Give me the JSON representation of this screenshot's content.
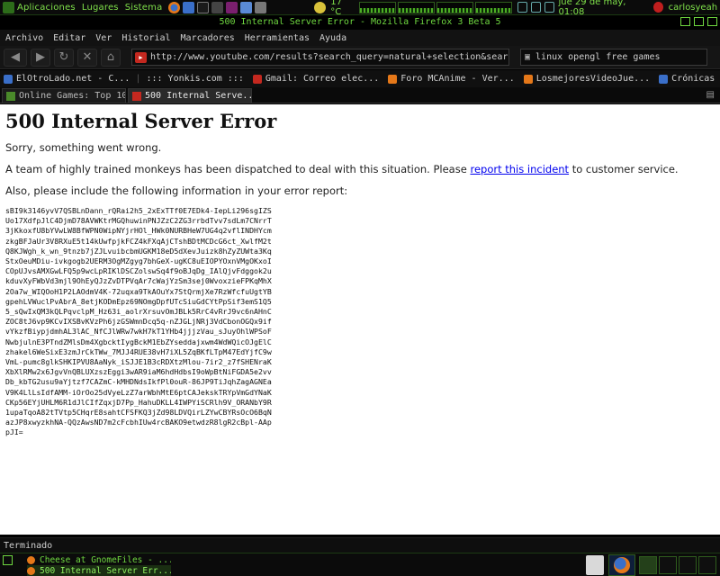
{
  "top_panel": {
    "menus": [
      "Aplicaciones",
      "Lugares",
      "Sistema"
    ],
    "weather": "17 °C",
    "clock": "jue 29 de may, 01:08",
    "user": "carlosyeah"
  },
  "window": {
    "title": "500 Internal Server Error - Mozilla Firefox 3 Beta 5"
  },
  "menubar": {
    "items": [
      "Archivo",
      "Editar",
      "Ver",
      "Historial",
      "Marcadores",
      "Herramientas",
      "Ayuda"
    ]
  },
  "navigation": {
    "url": "http://www.youtube.com/results?search_query=natural+selection&search",
    "search_value": "linux opengl free games"
  },
  "bookmarks": {
    "items": [
      "ElOtroLado.net - C...",
      "::: Yonkis.com :::",
      "Gmail: Correo elec...",
      "Foro MCAnime - Ver...",
      "LosmejoresVideoJue...",
      "Crónicas Roleras -..."
    ]
  },
  "tabs": {
    "items": [
      {
        "label": "Online Games: Top 10 ..."
      },
      {
        "label": "500 Internal Serve..."
      }
    ]
  },
  "page": {
    "heading": "500 Internal Server Error",
    "sorry": "Sorry, something went wrong.",
    "monkeys_before": "A team of highly trained monkeys has been dispatched to deal with this situation. Please ",
    "monkeys_link": "report this incident",
    "monkeys_after": " to customer service.",
    "also": "Also, please include the following information in your error report:",
    "error_report": "sBI9k3146yvV7QSBLnDann_rQRai2h5_2xExTTf0E7EDk4-IepLi296sgIZS\nUo17XdfpJlC4DjmD78AVWKtrMGQhuwinPNJZzC2ZG3rrbdTvv7sdLm7CNrrT\n3jKkoxfU8bYVwLW8BfWPN0WipNYjrHOl_HWk0NURBHeW7UG4q2vflINDHYcm\nzkgBFJaUr3V8RXuE5t14kUwfpjkFCZ4kFXqAjCTshBDtMCDcG6ct_XwlfM2t\nQ8KJWgh_k_wn_9tnzb7jZJLvuibcbmUGKM18eD5dXevJuizk8hZyZUWta3Kq\nStxOeuMDiu-ivkgogb2UERM3OgMZgyg7bhGeX-ugKC8uEIOPYOxnVMgOKxoI\nCOpUJvsAMXGwLFQ5p9wcLpRIKlDSCZolswSq4f9oBJqDg_IAlQjvFdggok2u\nkduvXyFWbVd3mjl9OhEyQJzZvDTPVqAr7cWajYzSm3sej0WvoxzieFPKqMhX\n2Oa7w_WIQOoH1P2LAOdmV4K-72uqxa9TkAOuYx7StQrmjXe7RzWfcfuUgtYB\ngpehLVWuclPvAbrA_8etjKODmEpz69NOmgDpfUTcSiuGdCYtPpSif3emS1Q5\n5_sQwIxQM3kQLPqvclpM_Hz63i_aolrXrsuvOmJBLk5RrC4vRrJ9vc6nAHnC\nZOC8tJ6vp9KCvIXSBvKVzPh6jzGSWmnDcq5q-nZJGLjNRj3VdCbonOGQx9if\nvYkzfBiypjdmhAL3lAC_NfCJlWRw7wkH7kT1YHb4jjjzVau_sJuyOhlWPSoF\nNwbjulnE3PTndZMlsDm4XgbcktIygBckM1EbZYseddajxwm4WdWQicOJgElC\nzhakel6WeSixE3zmJrCkTWw_7MJJ4RUE38vH7iXL5ZqBKfLTpM47EdYjfC9w\nVmL-pumc8glkSHKIPVU8AaNyk_iSJJE1B3cRDXtzMlou-7ir2_z7fSHENraK\nXbXlRMw2x6JgvVnQBLUXzszEggi3wAR9iaM6hdHdbsI9oWpBtNiFGDA5e2vv\nDb_kbTG2usu9aYjtzf7CAZmC-kMHDNdsIkfPl0ouR-86JP9TiJqhZagAGNEa\nV9K4LlLsIdfAMM-iOrOo25dVyeLzZ7arWbhMtE6ptCAJekskTRYpVmGdYNaK\nCKp56EYjUHLM6R1dJlCIfZqxjD7Pp_HahuDKLL4IWPYiSCRlh9V_ORANbY9R\n1upaTqoA82tTVtp5CHqrE8sahtCFSFKQ3jZd98LDVQirLZYwCBYRsOcO6BqN\nazJP8xwyzkhNA-QQzAwsND7m2cFcbhIUw4rcBAKO9etwdzR8lgR2cBpl-AAp\npJI="
  },
  "statusbar": {
    "text": "Terminado"
  },
  "taskbar": {
    "items": [
      {
        "label": "Cheese at GnomeFiles - ..."
      },
      {
        "label": "500 Internal Server Err..."
      }
    ]
  }
}
